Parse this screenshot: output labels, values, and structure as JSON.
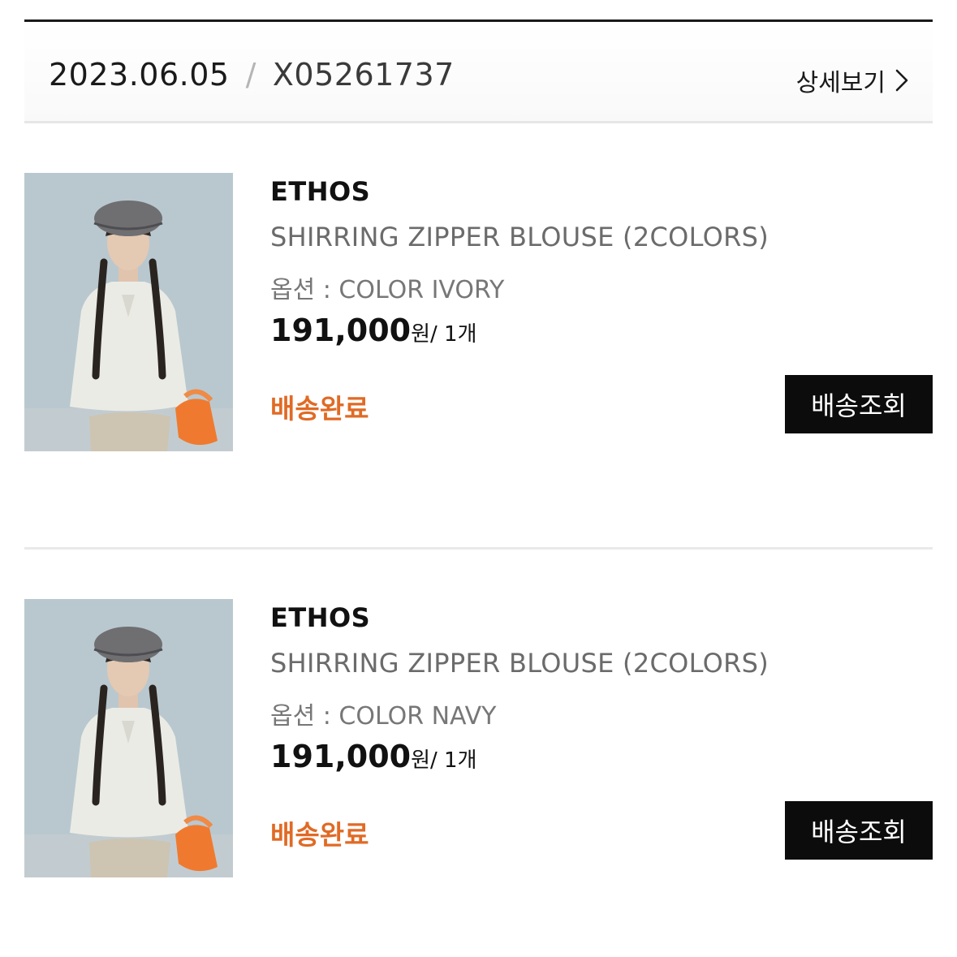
{
  "order": {
    "date": "2023.06.05",
    "separator": "/",
    "order_no": "X05261737",
    "detail_label": "상세보기"
  },
  "items": [
    {
      "brand": "ETHOS",
      "name": "SHIRRING ZIPPER BLOUSE (2COLORS)",
      "option": "옵션 : COLOR IVORY",
      "price": "191,000",
      "currency": "원",
      "qty": "/ 1개",
      "status": "배송완료",
      "track_label": "배송조회"
    },
    {
      "brand": "ETHOS",
      "name": "SHIRRING ZIPPER BLOUSE (2COLORS)",
      "option": "옵션 : COLOR NAVY",
      "price": "191,000",
      "currency": "원",
      "qty": "/ 1개",
      "status": "배송완료",
      "track_label": "배송조회"
    }
  ],
  "colors": {
    "status": "#e06a25",
    "button_bg": "#0c0c0c",
    "button_text": "#ffffff"
  },
  "icons": {
    "detail_arrow": "chevron-right-icon",
    "thumbnail": "product-photo"
  }
}
